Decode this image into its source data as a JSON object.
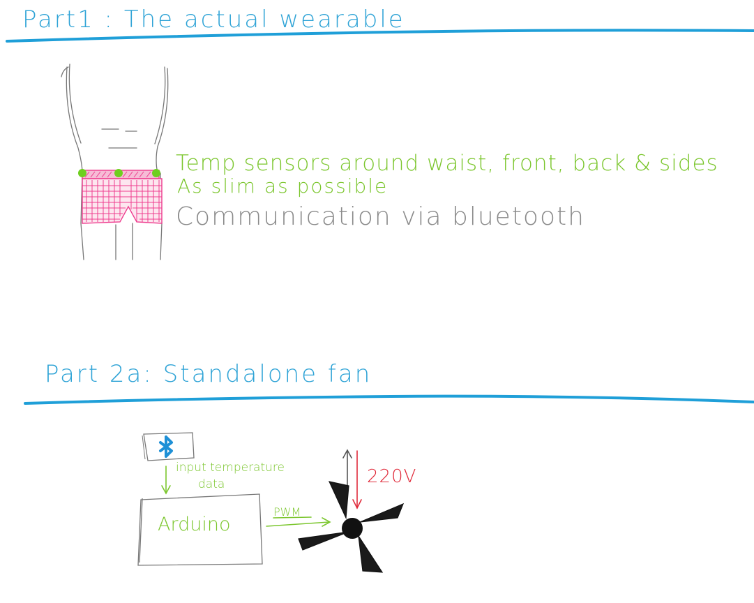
{
  "part1": {
    "heading": "Part1 : The actual wearable",
    "note_sensors": "Temp sensors around waist, front, back & sides",
    "note_slim": "As slim as possible",
    "note_comm": "Communication via bluetooth"
  },
  "part2a": {
    "heading": "Part 2a: Standalone fan",
    "input_label": "input temperature",
    "input_label_2": "data",
    "arduino_label": "Arduino",
    "pwm_label": "PWM",
    "voltage_label": "220V"
  },
  "colors": {
    "heading": "#2ea3d6",
    "note_green": "#7bc62d",
    "note_gray": "#8a8a8a",
    "voltage_red": "#e02a3a",
    "sensor_dot": "#6fcf1f",
    "fabric_pink": "#ee3d8f",
    "bluetooth_blue": "#1e90d6"
  }
}
